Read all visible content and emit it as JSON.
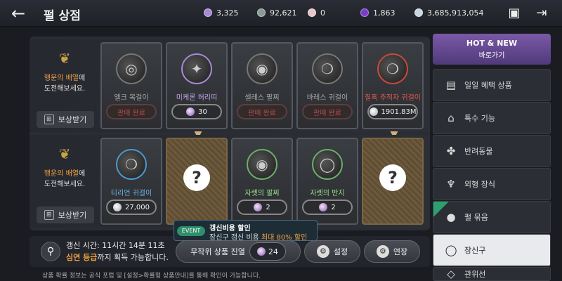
{
  "header": {
    "title": "펄 상점",
    "currencies": [
      {
        "value": "3,325",
        "icon": "purple-gem-icon",
        "color": "#a68ad8"
      },
      {
        "value": "92,621",
        "icon": "silver-coin-icon",
        "color": "#8a9b94"
      },
      {
        "value": "0",
        "icon": "pink-pearl-icon",
        "color": "#e8c7cc"
      },
      {
        "value": "1,863",
        "icon": "violet-pearl-icon",
        "color": "#7a3cc9"
      },
      {
        "value": "3,685,913,054",
        "icon": "silver-pearl-icon",
        "color": "#c9d6e0"
      }
    ]
  },
  "rows": [
    {
      "lucky": {
        "hl": "행운의 배열",
        "rest1": "에",
        "line2": "도전해보세요."
      },
      "reward_label": "보상받기",
      "items": [
        {
          "name": "엘크 목걸이",
          "price": "판매 완료",
          "sold": true,
          "icon": "necklace-icon"
        },
        {
          "name": "미케론 허리띠",
          "price": "30",
          "sold": false,
          "icon": "belt-icon",
          "name_color": "#c7a7e8"
        },
        {
          "name": "셀레스 팔찌",
          "price": "판매 완료",
          "sold": true,
          "icon": "bracelet-icon"
        },
        {
          "name": "바레스 귀걸이",
          "price": "판매 완료",
          "sold": true,
          "icon": "earring-icon"
        },
        {
          "name": "칠흑 추적자 귀걸이",
          "price": "1901.83M",
          "sold": false,
          "icon": "earring-icon",
          "name_color": "#e35a4a"
        }
      ]
    },
    {
      "lucky": {
        "hl": "행운의 배열",
        "rest1": "에",
        "line2": "도전해보세요."
      },
      "reward_label": "보상받기",
      "items": [
        {
          "name": "티리언 귀걸이",
          "price": "27,000",
          "sold": false,
          "icon": "earring-icon",
          "name_color": "#6ab7e8"
        },
        {
          "name": "",
          "price": "",
          "hidden": true
        },
        {
          "name": "자렛의 팔찌",
          "price": "2",
          "sold": false,
          "icon": "bracelet-icon",
          "name_color": "#9be08a"
        },
        {
          "name": "자렛의 반지",
          "price": "2",
          "sold": false,
          "icon": "ring-icon",
          "name_color": "#9be08a"
        },
        {
          "name": "",
          "price": "",
          "hidden": true
        }
      ]
    }
  ],
  "bottom": {
    "refresh_label": "갱신 시간: 11시간 14분 11초",
    "refresh_hl": "심연 등급",
    "refresh_rest": "까지 획득 가능합니다.",
    "event_badge": "EVENT",
    "event_title": "갱신비용 할인",
    "event_sub_pre": "장신구 갱신 비용 ",
    "event_sub_hl": "최대 80% 할인",
    "random_label": "무작위 상품 진열",
    "random_cost": "24",
    "settings_label": "설정",
    "extend_label": "연장",
    "footer": "상품 확률 정보는 공식 포럼 및 [설정>확률형 상품안내]를 통해 확인이 가능합니다."
  },
  "sidebar": {
    "hot_title": "HOT & NEW",
    "hot_sub": "바로가기",
    "items": [
      {
        "label": "일일 혜택 상품",
        "icon": "daily-icon"
      },
      {
        "label": "특수 기능",
        "icon": "special-icon"
      },
      {
        "label": "반려동물",
        "icon": "paw-icon"
      },
      {
        "label": "외형 장식",
        "icon": "costume-icon"
      },
      {
        "label": "펄 묶음",
        "icon": "pearl-bundle-icon",
        "new": true
      },
      {
        "label": "장신구",
        "icon": "ring-icon",
        "active": true
      },
      {
        "label": "관위선",
        "icon": "more-icon"
      }
    ]
  }
}
